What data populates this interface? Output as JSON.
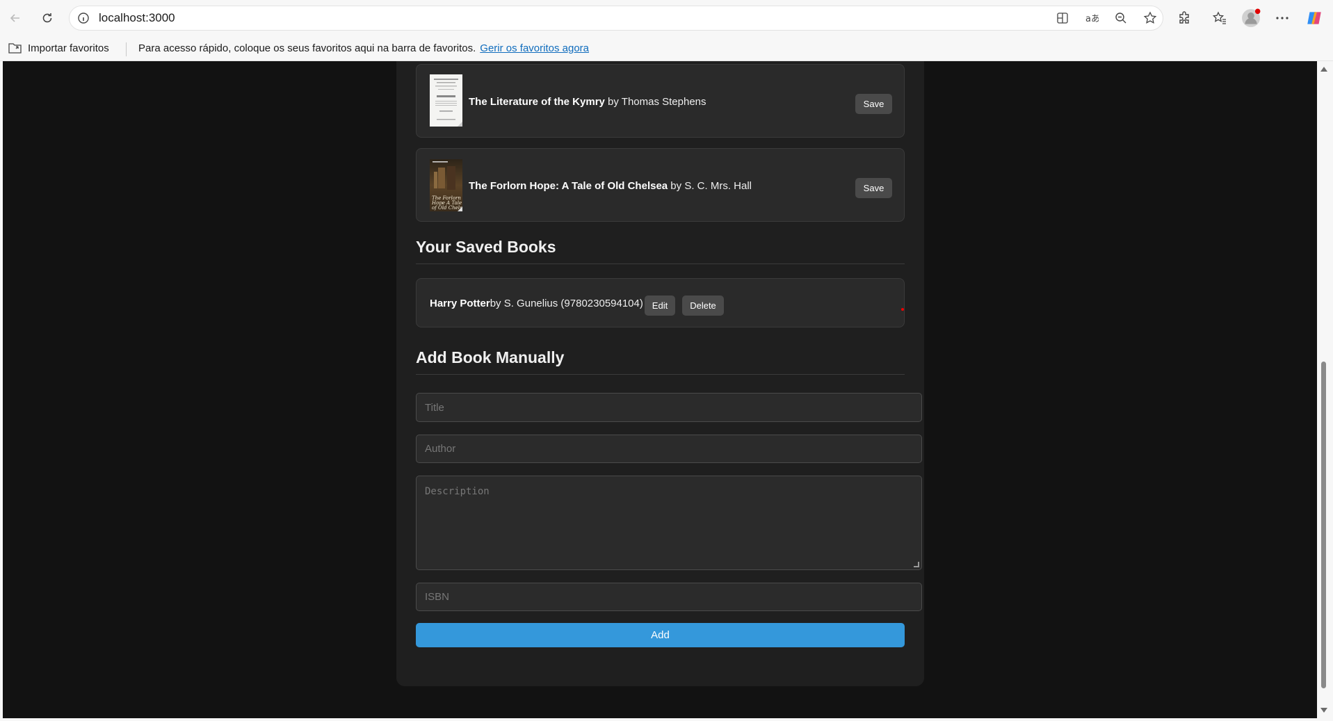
{
  "browser": {
    "url": "localhost:3000",
    "favorites_import_label": "Importar favoritos",
    "favorites_message": "Para acesso rápido, coloque os seus favoritos aqui na barra de favoritos.",
    "favorites_link": "Gerir os favoritos agora"
  },
  "search_results": [
    {
      "title": "The Literature of the Kymry",
      "author_prefix": " by ",
      "author": "Thomas Stephens",
      "save_label": "Save"
    },
    {
      "title": "The Forlorn Hope: A Tale of Old Chelsea",
      "author_prefix": " by ",
      "author": "S. C. Mrs. Hall",
      "save_label": "Save"
    }
  ],
  "saved_section": {
    "heading": "Your Saved Books",
    "books": [
      {
        "title": "Harry Potter",
        "details": "by S. Gunelius (9780230594104)",
        "edit_label": "Edit",
        "delete_label": "Delete"
      }
    ]
  },
  "add_section": {
    "heading": "Add Book Manually",
    "title_placeholder": "Title",
    "author_placeholder": "Author",
    "description_placeholder": "Description",
    "isbn_placeholder": "ISBN",
    "add_label": "Add"
  },
  "colors": {
    "page_bg": "#121212",
    "panel_bg": "#1f1f1f",
    "card_bg": "#2a2a2a",
    "accent": "#3498db"
  }
}
